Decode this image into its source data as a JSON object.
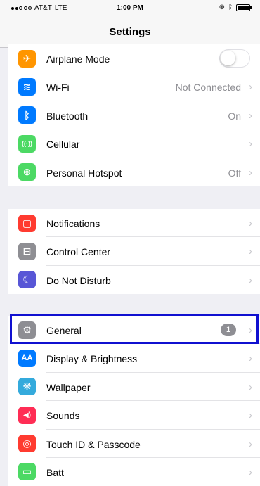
{
  "status_bar": {
    "carrier": "AT&T",
    "network": "LTE",
    "time": "1:00 PM"
  },
  "nav": {
    "title": "Settings"
  },
  "colors": {
    "airplane": "#ff9500",
    "wifi": "#007aff",
    "bluetooth": "#007aff",
    "cellular": "#4cd964",
    "hotspot": "#4cd964",
    "notifications": "#ff3b30",
    "control_center": "#8e8e93",
    "dnd": "#5856d6",
    "general": "#8e8e93",
    "display": "#007aff",
    "wallpaper": "#34aadc",
    "sounds": "#ff2d55",
    "touchid": "#ff3b30",
    "battery": "#4cd964",
    "highlight": "#1010d0"
  },
  "groups": [
    {
      "items": [
        {
          "label": "Airplane Mode",
          "icon": "airplane-icon",
          "glyph": "✈",
          "toggle_on": false
        },
        {
          "label": "Wi-Fi",
          "icon": "wifi-icon",
          "glyph": "≋",
          "value": "Not Connected"
        },
        {
          "label": "Bluetooth",
          "icon": "bluetooth-icon",
          "glyph": "ᛒ",
          "value": "On"
        },
        {
          "label": "Cellular",
          "icon": "cellular-icon",
          "glyph": "((·))"
        },
        {
          "label": "Personal Hotspot",
          "icon": "hotspot-icon",
          "glyph": "⊚",
          "value": "Off"
        }
      ]
    },
    {
      "items": [
        {
          "label": "Notifications",
          "icon": "notifications-icon",
          "glyph": "▢"
        },
        {
          "label": "Control Center",
          "icon": "control-center-icon",
          "glyph": "⊟"
        },
        {
          "label": "Do Not Disturb",
          "icon": "moon-icon",
          "glyph": "☾"
        }
      ]
    },
    {
      "items": [
        {
          "label": "General",
          "icon": "gear-icon",
          "glyph": "⚙",
          "badge": "1"
        },
        {
          "label": "Display & Brightness",
          "icon": "display-icon",
          "glyph": "AA"
        },
        {
          "label": "Wallpaper",
          "icon": "wallpaper-icon",
          "glyph": "❋"
        },
        {
          "label": "Sounds",
          "icon": "sounds-icon",
          "glyph": "◀)"
        },
        {
          "label": "Touch ID & Passcode",
          "icon": "fingerprint-icon",
          "glyph": "◎"
        },
        {
          "label": "Batt",
          "icon": "battery-icon",
          "glyph": "▭"
        }
      ]
    }
  ],
  "chevron": "›"
}
